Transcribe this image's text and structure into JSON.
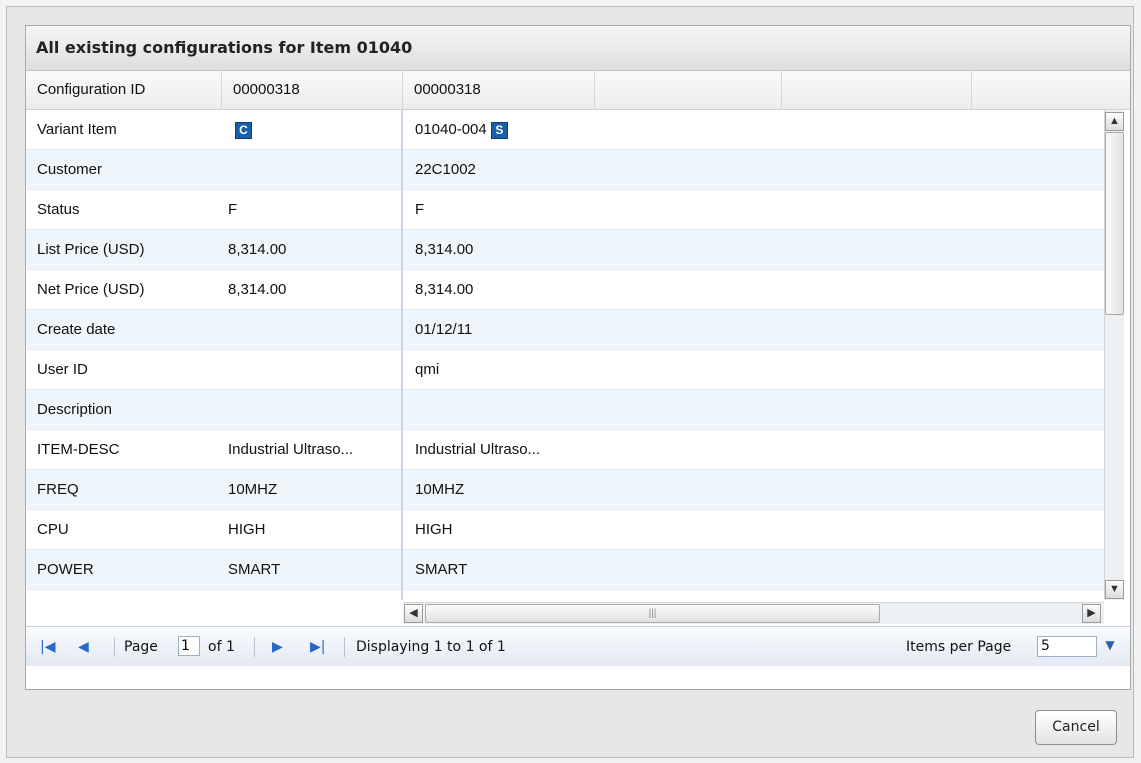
{
  "dialog": {
    "title": "All existing configurations for Item 01040"
  },
  "columns": {
    "label": "Configuration ID",
    "col1": "00000318",
    "col2": "00000318"
  },
  "rows": [
    {
      "label": "Variant Item",
      "v1_badge": "C",
      "v2": "01040-004",
      "v2_badge": "S"
    },
    {
      "label": "Customer",
      "v1": "",
      "v2": "22C1002"
    },
    {
      "label": "Status",
      "v1": "F",
      "v2": "F"
    },
    {
      "label": "List Price (USD)",
      "v1": "8,314.00",
      "v2": "8,314.00"
    },
    {
      "label": "Net Price (USD)",
      "v1": "8,314.00",
      "v2": "8,314.00"
    },
    {
      "label": "Create date",
      "v1": "",
      "v2": "01/12/11"
    },
    {
      "label": "User ID",
      "v1": "",
      "v2": "qmi"
    },
    {
      "label": "Description",
      "v1": "",
      "v2": ""
    },
    {
      "label": "ITEM-DESC",
      "v1": "Industrial Ultraso...",
      "v2": "Industrial Ultraso..."
    },
    {
      "label": "FREQ",
      "v1": "10MHZ",
      "v2": "10MHZ"
    },
    {
      "label": "CPU",
      "v1": "HIGH",
      "v2": "HIGH"
    },
    {
      "label": "POWER",
      "v1": "SMART",
      "v2": "SMART"
    }
  ],
  "pager": {
    "page_label": "Page",
    "page_value": "1",
    "of_label": "of 1",
    "displaying": "Displaying 1 to 1 of 1",
    "items_per_page_label": "Items per Page",
    "items_per_page_value": "5"
  },
  "buttons": {
    "cancel": "Cancel"
  },
  "icons": {
    "first": "first-page-icon",
    "prev": "prev-page-icon",
    "next": "next-page-icon",
    "last": "last-page-icon"
  },
  "colors": {
    "accent": "#2a67c7",
    "badge": "#1a5ea7",
    "alt_row": "#eef5fb"
  }
}
